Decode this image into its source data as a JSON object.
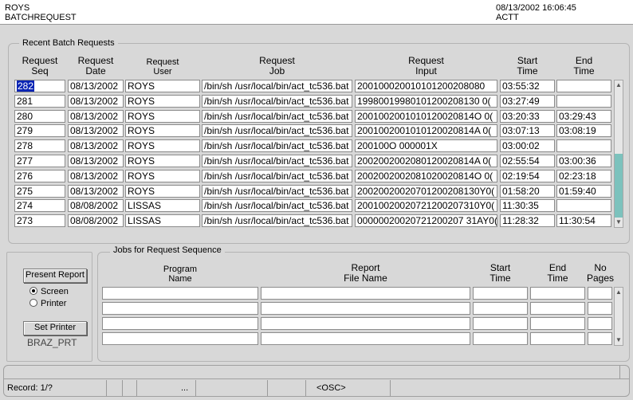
{
  "header": {
    "user": "ROYS",
    "form": "BATCHREQUEST",
    "datetime": "08/13/2002 16:06:45",
    "db": "ACTT"
  },
  "batch": {
    "legend": "Recent Batch Requests",
    "headers": [
      [
        "Request",
        "Seq"
      ],
      [
        "Request",
        "Date"
      ],
      [
        "Request",
        "User"
      ],
      [
        "Request",
        "Job"
      ],
      [
        "Request",
        "Input"
      ],
      [
        "Start",
        "Time"
      ],
      [
        "End",
        "Time"
      ]
    ],
    "rows": [
      {
        "seq": "282",
        "date": "08/13/2002",
        "user": "ROYS",
        "job": "/bin/sh /usr/local/bin/act_tc536.bat",
        "input": "200100020010101200208080",
        "start": "03:55:32",
        "end": ""
      },
      {
        "seq": "281",
        "date": "08/13/2002",
        "user": "ROYS",
        "job": "/bin/sh /usr/local/bin/act_tc536.bat",
        "input": "19980019980101200208130 0(",
        "start": "03:27:49",
        "end": ""
      },
      {
        "seq": "280",
        "date": "08/13/2002",
        "user": "ROYS",
        "job": "/bin/sh /usr/local/bin/act_tc536.bat",
        "input": "2001002001010120020814O 0(",
        "start": "03:20:33",
        "end": "03:29:43"
      },
      {
        "seq": "279",
        "date": "08/13/2002",
        "user": "ROYS",
        "job": "/bin/sh /usr/local/bin/act_tc536.bat",
        "input": "2001002001010120020814A 0(",
        "start": "03:07:13",
        "end": "03:08:19"
      },
      {
        "seq": "278",
        "date": "08/13/2002",
        "user": "ROYS",
        "job": "/bin/sh /usr/local/bin/act_tc536.bat",
        "input": "200100O 000001X",
        "start": "03:00:02",
        "end": ""
      },
      {
        "seq": "277",
        "date": "08/13/2002",
        "user": "ROYS",
        "job": "/bin/sh /usr/local/bin/act_tc536.bat",
        "input": "2002002002080120020814A 0(",
        "start": "02:55:54",
        "end": "03:00:36"
      },
      {
        "seq": "276",
        "date": "08/13/2002",
        "user": "ROYS",
        "job": "/bin/sh /usr/local/bin/act_tc536.bat",
        "input": "2002002002081020020814O 0(",
        "start": "02:19:54",
        "end": "02:23:18"
      },
      {
        "seq": "275",
        "date": "08/13/2002",
        "user": "ROYS",
        "job": "/bin/sh /usr/local/bin/act_tc536.bat",
        "input": "20020020020701200208130Y0(",
        "start": "01:58:20",
        "end": "01:59:40"
      },
      {
        "seq": "274",
        "date": "08/08/2002",
        "user": "LISSAS",
        "job": "/bin/sh /usr/local/bin/act_tc536.bat",
        "input": "20010020020721200207310Y0(",
        "start": "11:30:35",
        "end": ""
      },
      {
        "seq": "273",
        "date": "08/08/2002",
        "user": "LISSAS",
        "job": "/bin/sh /usr/local/bin/act_tc536.bat",
        "input": "00000020020721200207 31AY0(",
        "start": "11:28:32",
        "end": "11:30:54"
      }
    ]
  },
  "options": {
    "present_label": "Present Report",
    "screen_label": "Screen",
    "printer_label": "Printer",
    "selected_destination": "Screen",
    "set_printer_label": "Set Printer",
    "printer_name": "BRAZ_PRT"
  },
  "jobs": {
    "legend": "Jobs for Request Sequence",
    "headers": [
      [
        "Program",
        "Name"
      ],
      [
        "Report",
        "File Name"
      ],
      [
        "Start",
        "Time"
      ],
      [
        "End",
        "Time"
      ],
      [
        "No",
        "Pages"
      ]
    ]
  },
  "status": {
    "record": "Record: 1/?",
    "ellipsis": "...",
    "mode": "<OSC>"
  }
}
